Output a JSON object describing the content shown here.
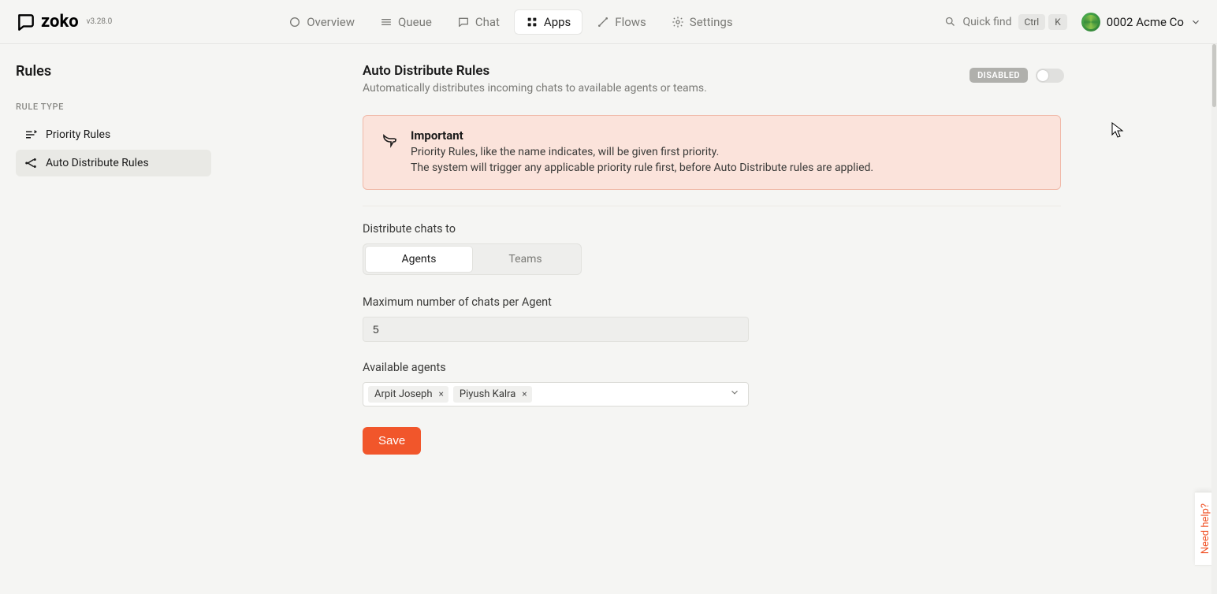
{
  "brand": {
    "name": "zoko",
    "version": "v3.28.0"
  },
  "nav": {
    "overview": "Overview",
    "queue": "Queue",
    "chat": "Chat",
    "apps": "Apps",
    "flows": "Flows",
    "settings": "Settings"
  },
  "search": {
    "placeholder": "Quick find",
    "kbd1": "Ctrl",
    "kbd2": "K"
  },
  "org": {
    "name": "0002 Acme Co"
  },
  "sidebar": {
    "title": "Rules",
    "section_label": "RULE TYPE",
    "items": [
      {
        "label": "Priority Rules"
      },
      {
        "label": "Auto Distribute Rules"
      }
    ]
  },
  "page": {
    "title": "Auto Distribute Rules",
    "subtitle": "Automatically distributes incoming chats to available agents or teams.",
    "status_label": "DISABLED"
  },
  "alert": {
    "heading": "Important",
    "line1": "Priority Rules, like the name indicates, will be given first priority.",
    "line2": "The system will trigger any applicable priority rule first, before Auto Distribute rules are applied."
  },
  "form": {
    "distribute_label": "Distribute chats to",
    "seg_agents": "Agents",
    "seg_teams": "Teams",
    "max_label": "Maximum number of chats per Agent",
    "max_value": "5",
    "agents_label": "Available agents",
    "agents": [
      {
        "name": "Arpit Joseph"
      },
      {
        "name": "Piyush Kalra"
      }
    ],
    "save": "Save"
  },
  "help": "Need help?"
}
